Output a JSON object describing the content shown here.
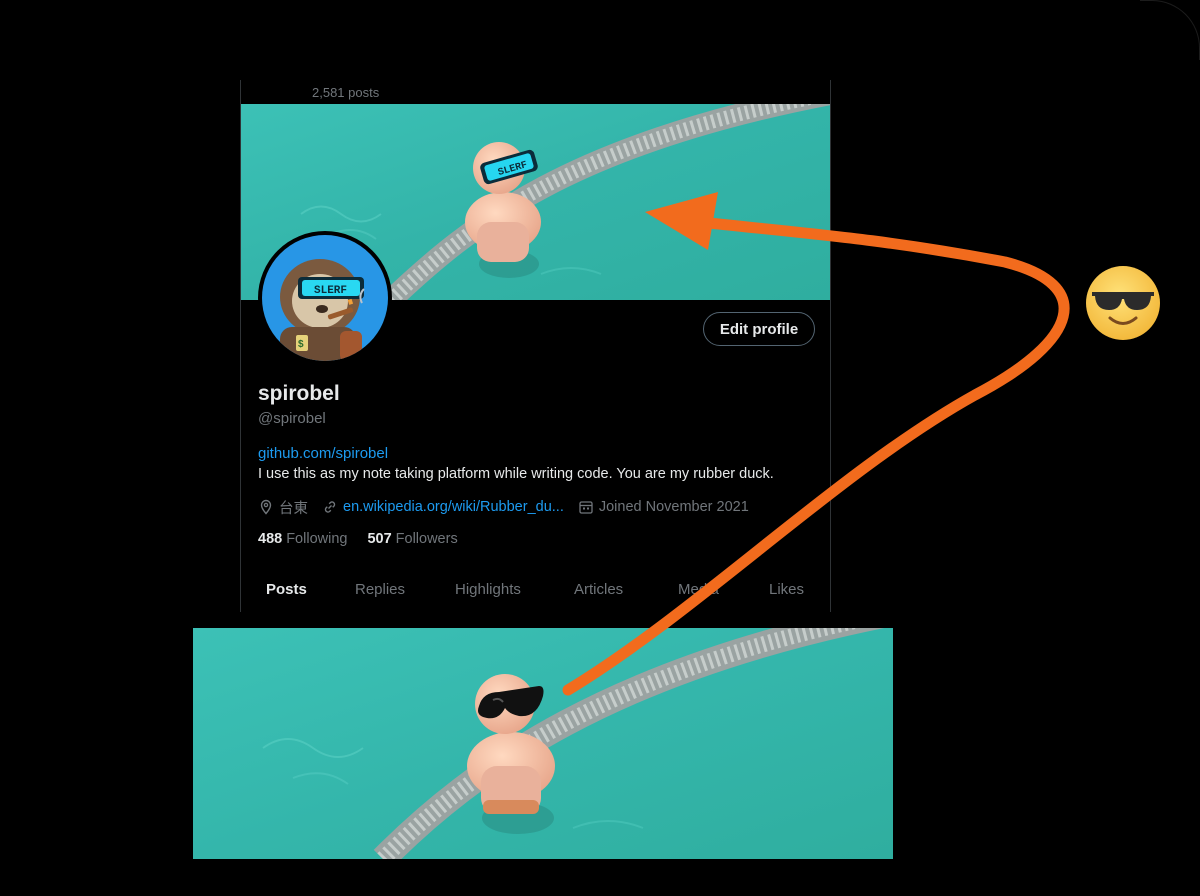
{
  "profile": {
    "posts_count": "2,581 posts",
    "display_name": "spirobel",
    "handle": "@spirobel",
    "edit_button_label": "Edit profile",
    "bio_link": "github.com/spirobel",
    "bio_text": "I use this as my note taking platform while writing code. You are my rubber duck.",
    "location": "台東",
    "website": "en.wikipedia.org/wiki/Rubber_du...",
    "joined": "Joined November 2021",
    "following_count": "488",
    "following_label": "Following",
    "followers_count": "507",
    "followers_label": "Followers",
    "avatar_visor_text": "SLERF",
    "avatar_tag": "$",
    "banner_visor_text": "SLERF",
    "tabs": [
      {
        "label": "Posts",
        "active": true
      },
      {
        "label": "Replies",
        "active": false
      },
      {
        "label": "Highlights",
        "active": false
      },
      {
        "label": "Articles",
        "active": false
      },
      {
        "label": "Media",
        "active": false
      },
      {
        "label": "Likes",
        "active": false
      }
    ]
  },
  "icons": {
    "location": "location-pin-icon",
    "link": "link-icon",
    "calendar": "calendar-icon"
  },
  "overlay": {
    "emoji": "smiling-face-with-sunglasses",
    "arrow_color": "#f26b1d"
  },
  "colors": {
    "background": "#000000",
    "pool_water": "#35b7ac",
    "link_blue": "#1d9bf0",
    "muted_text": "#71767b",
    "primary_text": "#e7e9ea"
  }
}
